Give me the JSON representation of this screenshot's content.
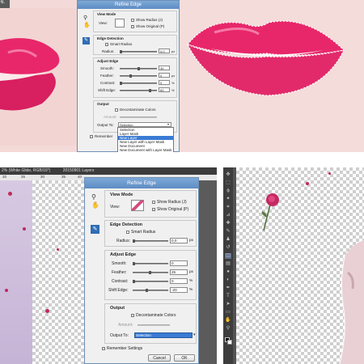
{
  "top": {
    "left_tab_text": "6.",
    "dialog": {
      "title": "Refine Edge",
      "view_mode": {
        "title": "View Mode",
        "view_label": "View:",
        "show_radius": "Show Radius (J)",
        "show_original": "Show Original (P)"
      },
      "edge_detection": {
        "title": "Edge Detection",
        "smart_radius": "Smart Radius",
        "radius_label": "Radius:",
        "radius_value": "0,0",
        "radius_unit": "px"
      },
      "adjust_edge": {
        "title": "Adjust Edge",
        "smooth_label": "Smooth:",
        "smooth_value": "30",
        "feather_label": "Feather:",
        "feather_value": "0",
        "feather_unit": "px",
        "contrast_label": "Contrast:",
        "contrast_value": "0",
        "contrast_unit": "%",
        "shift_label": "Shift Edge:",
        "shift_value": "60",
        "shift_unit": "%"
      },
      "output": {
        "title": "Output",
        "decontaminate": "Decontaminate Colors",
        "amount_label": "Amount:",
        "output_to_label": "Output To:",
        "output_to_value": "Selection",
        "remember": "Remember"
      },
      "menu_options": [
        "Selection",
        "Layer Mask",
        "New Layer",
        "New Layer with Layer Mask",
        "New Document",
        "New Document with Layer Mask"
      ],
      "menu_selected_index": 2
    }
  },
  "bottom": {
    "doc_tab": "2% (White Glide, RGB/16*)",
    "doc_tab2": "20150901 Layers",
    "ruler": [
      "20",
      "25",
      "30",
      "35",
      "40"
    ],
    "dialog": {
      "title": "Refine Edge",
      "view_mode": {
        "title": "View Mode",
        "view_label": "View:",
        "show_radius": "Show Radius (J)",
        "show_original": "Show Original (P)"
      },
      "edge_detection": {
        "title": "Edge Detection",
        "smart_radius": "Smart Radius",
        "radius_label": "Radius:",
        "radius_value": "0,0",
        "radius_unit": "px"
      },
      "adjust_edge": {
        "title": "Adjust Edge",
        "smooth_label": "Smooth:",
        "smooth_value": "0",
        "feather_label": "Feather:",
        "feather_value": "25",
        "feather_unit": "px",
        "contrast_label": "Contrast:",
        "contrast_value": "0",
        "contrast_unit": "%",
        "shift_label": "Shift Edge:",
        "shift_value": "-20",
        "shift_unit": "%"
      },
      "output": {
        "title": "Output",
        "decontaminate": "Decontaminate Colors",
        "amount_label": "Amount:",
        "output_to_label": "Output To:",
        "output_to_value": "Selection",
        "remember": "Remember Settings"
      },
      "cancel": "Cancel",
      "ok": "OK"
    }
  },
  "colors": {
    "lipstick": "#e8276a",
    "skin": "#f0d2d2",
    "dialog_bg": "#f0f0f0",
    "title_blue": "#6b98cf",
    "menu_highlight": "#3a7bd5",
    "ps_dark": "#535353"
  },
  "icons": [
    "zoom-icon",
    "hand-icon",
    "refine-radius-brush-icon",
    "rose-flower-icon"
  ]
}
